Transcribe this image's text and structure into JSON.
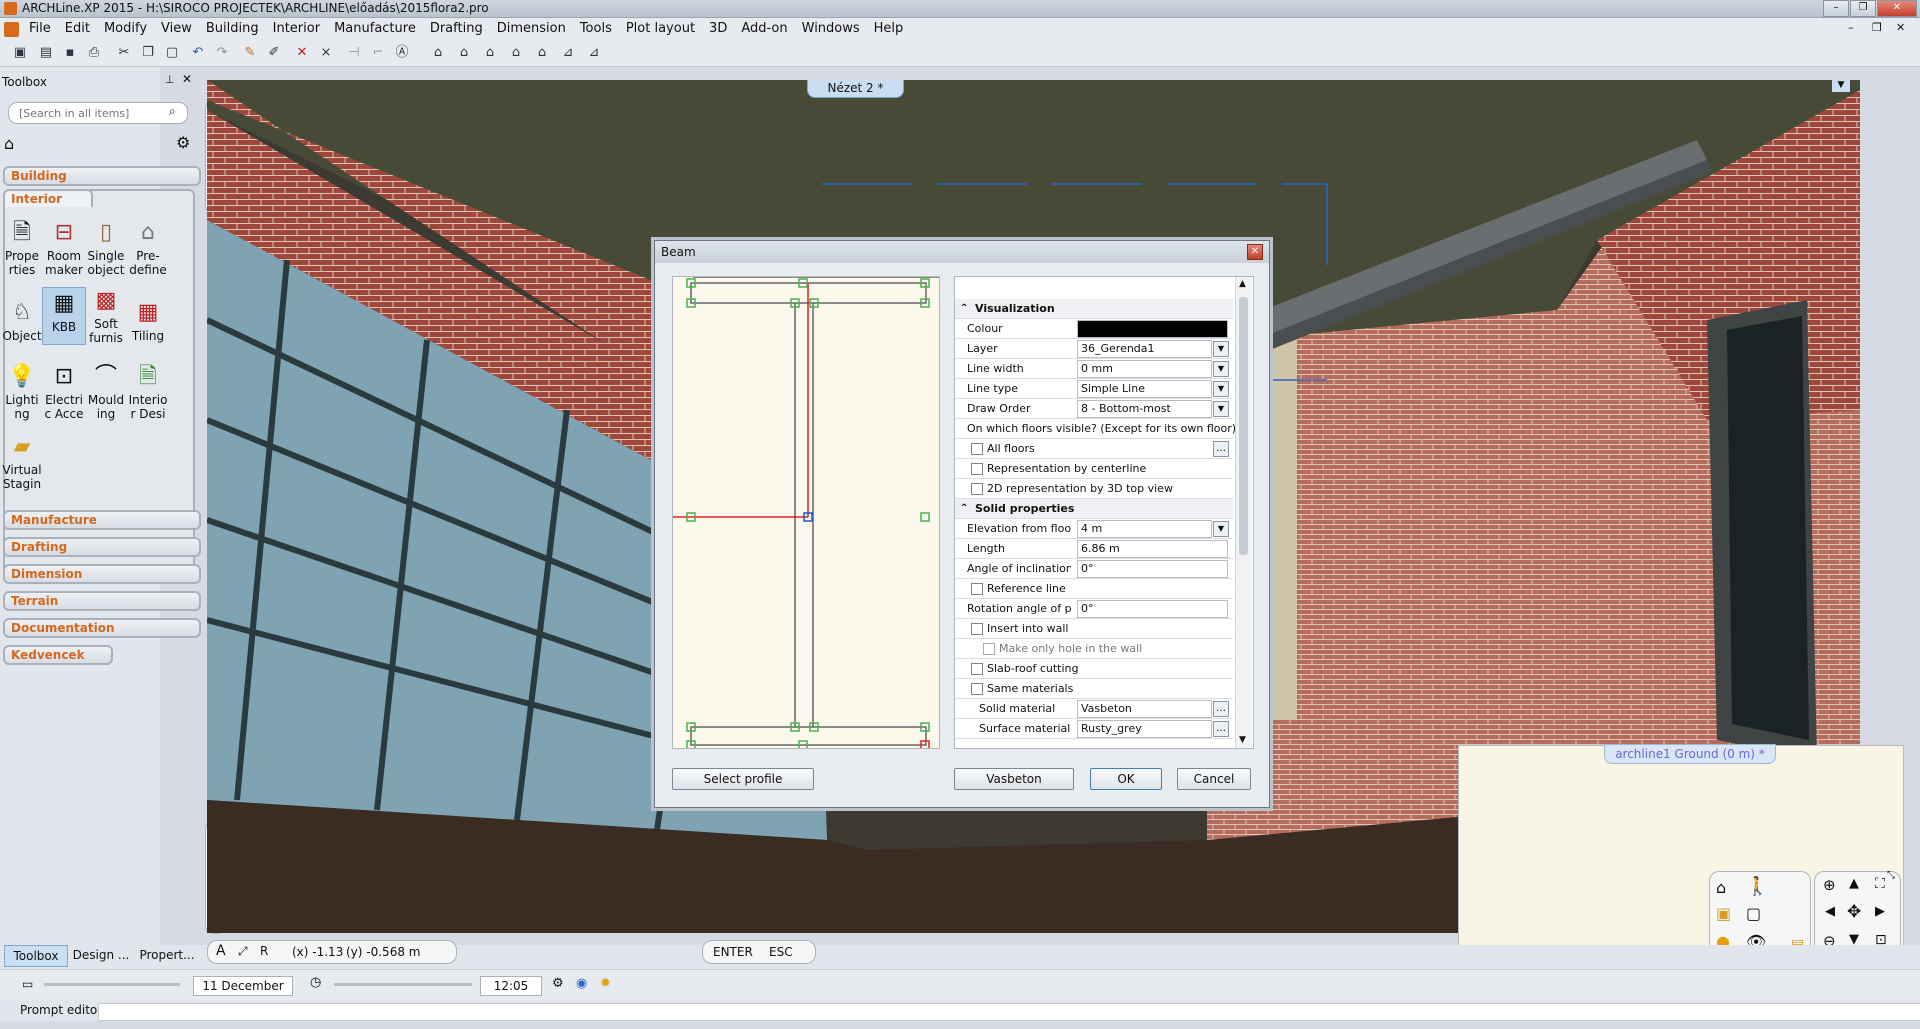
{
  "window": {
    "title": "ARCHLine.XP 2015 - H:\\SIROCO PROJECTEK\\ARCHLINE\\előadás\\2015flora2.pro"
  },
  "menu": [
    "File",
    "Edit",
    "Modify",
    "View",
    "Building",
    "Interior",
    "Manufacture",
    "Drafting",
    "Dimension",
    "Tools",
    "Plot layout",
    "3D",
    "Add-on",
    "Windows",
    "Help"
  ],
  "toolbox": {
    "title": "Toolbox",
    "search_placeholder": "[Search in all items]",
    "categories_top": [
      "Building",
      "Interior"
    ],
    "tools": [
      {
        "label": "Prope rties",
        "icon": "properties-icon"
      },
      {
        "label": "Room maker",
        "icon": "room-maker-icon"
      },
      {
        "label": "Single object",
        "icon": "single-object-icon"
      },
      {
        "label": "Pre- define",
        "icon": "predefine-icon"
      },
      {
        "label": "Object",
        "icon": "object-icon"
      },
      {
        "label": "KBB",
        "icon": "kbb-icon"
      },
      {
        "label": "Soft furnis",
        "icon": "soft-furnishing-icon"
      },
      {
        "label": "Tiling",
        "icon": "tiling-icon"
      },
      {
        "label": "Lighti ng",
        "icon": "lighting-icon"
      },
      {
        "label": "Electri c Acce",
        "icon": "electric-icon"
      },
      {
        "label": "Mould ing",
        "icon": "moulding-icon"
      },
      {
        "label": "Interio r Desi",
        "icon": "interior-design-icon"
      },
      {
        "label": "Virtual Stagin",
        "icon": "virtual-staging-icon"
      }
    ],
    "categories_bottom": [
      "Manufacture",
      "Drafting",
      "Dimension",
      "Terrain",
      "Documentation",
      "Kedvencek"
    ]
  },
  "viewport": {
    "tab": "Nézet 2 *"
  },
  "dialog": {
    "title": "Beam",
    "section_visualization": "Visualization",
    "rows_vis": [
      {
        "label": "Colour",
        "value": "",
        "type": "colour"
      },
      {
        "label": "Layer",
        "value": "36_Gerenda1",
        "type": "dropdown"
      },
      {
        "label": "Line width",
        "value": "0 mm",
        "type": "dropdown"
      },
      {
        "label": "Line type",
        "value": "Simple Line",
        "type": "dropdown"
      },
      {
        "label": "Draw Order",
        "value": "8 - Bottom-most",
        "type": "dropdown"
      }
    ],
    "floors_question": "On which floors visible? (Except for its own floor)",
    "all_floors": "All floors",
    "rep_centerline": "Representation by centerline",
    "rep_2d": "2D representation by 3D top view",
    "section_solid": "Solid properties",
    "elevation_label": "Elevation from floor",
    "elevation_value": "4 m",
    "length_label": "Length",
    "length_value": "6.86 m",
    "angle_label": "Angle of inclination",
    "angle_value": "0°",
    "reference_line": "Reference line",
    "rotation_label": "Rotation angle of pr...",
    "rotation_value": "0°",
    "insert_wall": "Insert into wall",
    "make_hole": "Make only hole in the wall",
    "slab_roof": "Slab-roof cutting",
    "same_materials": "Same materials",
    "solid_material_label": "Solid material",
    "solid_material_value": "Vasbeton",
    "surface_material_label": "Surface material",
    "surface_material_value": "Rusty_grey",
    "btn_select_profile": "Select profile",
    "btn_vasbeton": "Vasbeton",
    "btn_ok": "OK",
    "btn_cancel": "Cancel"
  },
  "minimap": {
    "tab": "archline1 Ground (0 m) *"
  },
  "coords": {
    "x": "(x) -1.13",
    "y": "(y) -0.568 m"
  },
  "enter_esc": {
    "enter": "ENTER",
    "esc": "ESC"
  },
  "bottom_tabs": [
    "Toolbox",
    "Design ...",
    "Propert..."
  ],
  "date": "11 December",
  "time": "12:05",
  "prompt": "Prompt editor"
}
